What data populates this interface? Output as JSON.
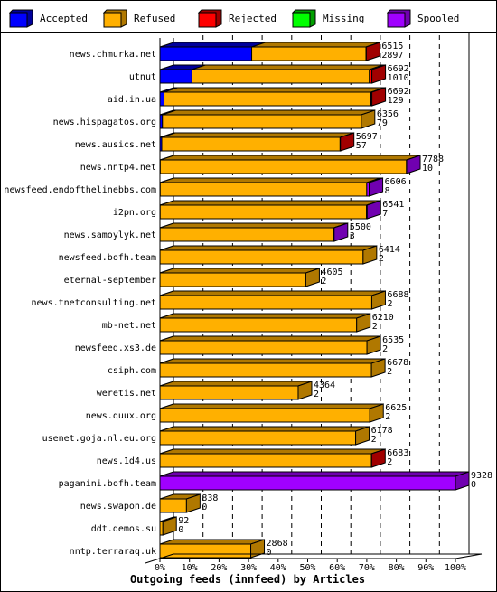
{
  "chart_data": {
    "type": "bar",
    "orientation": "horizontal",
    "stacked": true,
    "three_d": true,
    "title": "Outgoing feeds (innfeed) by Articles",
    "xlabel": "Outgoing feeds (innfeed) by Articles",
    "ylabel": "",
    "xlim": [
      0,
      100
    ],
    "x_unit": "% of maximum total articles",
    "x_ticks": [
      "0%",
      "10%",
      "20%",
      "30%",
      "40%",
      "50%",
      "60%",
      "70%",
      "80%",
      "90%",
      "100%"
    ],
    "max_total": 9328,
    "grid": true,
    "legend_position": "top",
    "legend": [
      {
        "name": "Accepted",
        "color": "#0000ff",
        "side": "#00009c"
      },
      {
        "name": "Refused",
        "color": "#ffb000",
        "side": "#b07800"
      },
      {
        "name": "Rejected",
        "color": "#ff0000",
        "side": "#a00000"
      },
      {
        "name": "Missing",
        "color": "#00ff00",
        "side": "#00a000"
      },
      {
        "name": "Spooled",
        "color": "#a000ff",
        "side": "#7000b0"
      }
    ],
    "categories": [
      {
        "name": "news.chmurka.net",
        "total": 6515,
        "accepted": 2897,
        "refused": 3608,
        "rejected": 10,
        "missing": 0,
        "spooled": 0,
        "end": "Rejected"
      },
      {
        "name": "utnut",
        "total": 6692,
        "accepted": 1010,
        "refused": 5602,
        "rejected": 80,
        "missing": 0,
        "spooled": 0,
        "end": "Rejected"
      },
      {
        "name": "aid.in.ua",
        "total": 6692,
        "accepted": 129,
        "refused": 6533,
        "rejected": 30,
        "missing": 0,
        "spooled": 0,
        "end": "Rejected"
      },
      {
        "name": "news.hispagatos.org",
        "total": 6356,
        "accepted": 79,
        "refused": 6277,
        "rejected": 0,
        "missing": 0,
        "spooled": 0,
        "end": "Refused"
      },
      {
        "name": "news.ausics.net",
        "total": 5697,
        "accepted": 57,
        "refused": 5630,
        "rejected": 10,
        "missing": 0,
        "spooled": 0,
        "end": "Rejected"
      },
      {
        "name": "news.nntp4.net",
        "total": 7788,
        "accepted": 10,
        "refused": 7773,
        "rejected": 0,
        "missing": 0,
        "spooled": 5,
        "end": "Spooled"
      },
      {
        "name": "newsfeed.endofthelinebbs.com",
        "total": 6606,
        "accepted": 8,
        "refused": 6520,
        "rejected": 0,
        "missing": 0,
        "spooled": 78,
        "end": "Spooled"
      },
      {
        "name": "i2pn.org",
        "total": 6541,
        "accepted": 7,
        "refused": 6514,
        "rejected": 0,
        "missing": 0,
        "spooled": 20,
        "end": "Spooled"
      },
      {
        "name": "news.samoylyk.net",
        "total": 5500,
        "accepted": 3,
        "refused": 5487,
        "rejected": 0,
        "missing": 0,
        "spooled": 10,
        "end": "Spooled"
      },
      {
        "name": "newsfeed.bofh.team",
        "total": 6414,
        "accepted": 2,
        "refused": 6412,
        "rejected": 0,
        "missing": 0,
        "spooled": 0,
        "end": "Refused"
      },
      {
        "name": "eternal-september",
        "total": 4605,
        "accepted": 2,
        "refused": 4603,
        "rejected": 0,
        "missing": 0,
        "spooled": 0,
        "end": "Refused"
      },
      {
        "name": "news.tnetconsulting.net",
        "total": 6688,
        "accepted": 2,
        "refused": 6686,
        "rejected": 0,
        "missing": 0,
        "spooled": 0,
        "end": "Refused"
      },
      {
        "name": "mb-net.net",
        "total": 6210,
        "accepted": 2,
        "refused": 6208,
        "rejected": 0,
        "missing": 0,
        "spooled": 0,
        "end": "Refused"
      },
      {
        "name": "newsfeed.xs3.de",
        "total": 6535,
        "accepted": 2,
        "refused": 6533,
        "rejected": 0,
        "missing": 0,
        "spooled": 0,
        "end": "Refused"
      },
      {
        "name": "csiph.com",
        "total": 6678,
        "accepted": 2,
        "refused": 6676,
        "rejected": 0,
        "missing": 0,
        "spooled": 0,
        "end": "Refused"
      },
      {
        "name": "weretis.net",
        "total": 4364,
        "accepted": 2,
        "refused": 4362,
        "rejected": 0,
        "missing": 0,
        "spooled": 0,
        "end": "Refused"
      },
      {
        "name": "news.quux.org",
        "total": 6625,
        "accepted": 2,
        "refused": 6623,
        "rejected": 0,
        "missing": 0,
        "spooled": 0,
        "end": "Refused"
      },
      {
        "name": "usenet.goja.nl.eu.org",
        "total": 6178,
        "accepted": 2,
        "refused": 6176,
        "rejected": 0,
        "missing": 0,
        "spooled": 0,
        "end": "Refused"
      },
      {
        "name": "news.1d4.us",
        "total": 6683,
        "accepted": 2,
        "refused": 6676,
        "rejected": 5,
        "missing": 0,
        "spooled": 0,
        "end": "Rejected"
      },
      {
        "name": "paganini.bofh.team",
        "total": 9328,
        "accepted": 0,
        "refused": 0,
        "rejected": 0,
        "missing": 0,
        "spooled": 9328,
        "end": "Spooled"
      },
      {
        "name": "news.swapon.de",
        "total": 838,
        "accepted": 0,
        "refused": 838,
        "rejected": 0,
        "missing": 0,
        "spooled": 0,
        "end": "Refused"
      },
      {
        "name": "ddt.demos.su",
        "total": 92,
        "accepted": 0,
        "refused": 92,
        "rejected": 0,
        "missing": 0,
        "spooled": 0,
        "end": "Refused"
      },
      {
        "name": "nntp.terraraq.uk",
        "total": 2868,
        "accepted": 0,
        "refused": 2868,
        "rejected": 0,
        "missing": 0,
        "spooled": 0,
        "end": "Refused"
      }
    ]
  }
}
